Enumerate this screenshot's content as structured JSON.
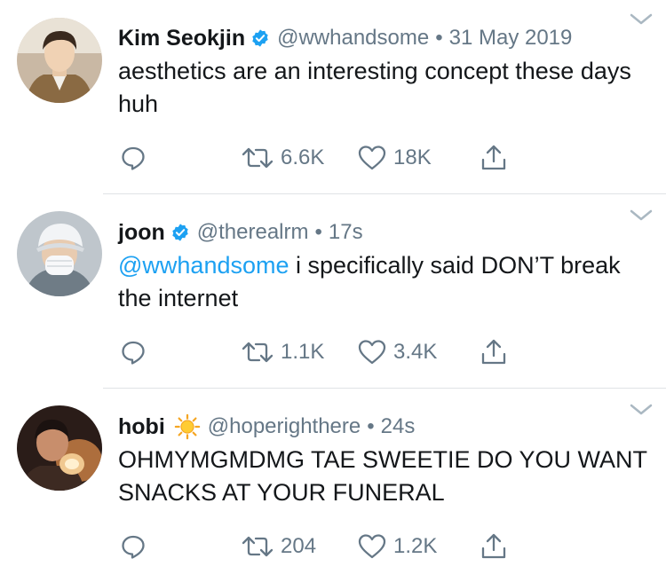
{
  "colors": {
    "text": "#14171a",
    "secondary": "#657786",
    "link": "#1da1f2",
    "verified": "#1da1f2",
    "divider": "#dfe3e6"
  },
  "tweets": [
    {
      "name": "Kim Seokjin",
      "badge": "verified-badge-icon",
      "handle": "@wwhandsome",
      "separator": "•",
      "time": "31 May 2019",
      "mention": "",
      "text": "aesthetics are an interesting concept these days huh",
      "retweets": "6.6K",
      "likes": "18K"
    },
    {
      "name": "joon",
      "badge": "verified-badge-icon",
      "handle": "@therealrm",
      "separator": "•",
      "time": "17s",
      "mention": "@wwhandsome",
      "text": " i specifically said DON’T break the internet",
      "retweets": "1.1K",
      "likes": "3.4K"
    },
    {
      "name": "hobi",
      "badge": "sun-emoji-icon",
      "handle": "@hoperighthere",
      "separator": "•",
      "time": "24s",
      "mention": "",
      "text": "OHMYMGMDMG TAE SWEETIE DO YOU WANT SNACKS AT YOUR FUNERAL",
      "retweets": "204",
      "likes": "1.2K"
    }
  ]
}
